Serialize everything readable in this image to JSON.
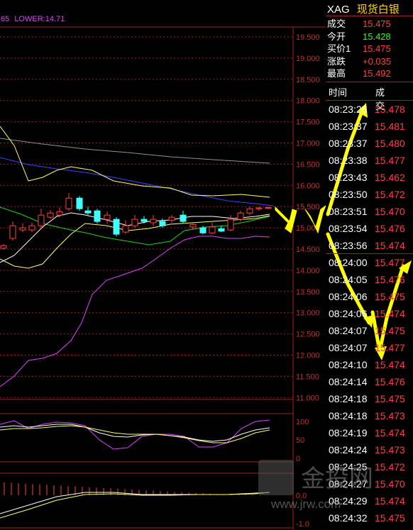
{
  "header": {
    "code": "XAG",
    "name": "现货白银"
  },
  "legend": {
    "partial_left": "65",
    "lower": "LOWER:14.71"
  },
  "quote": [
    {
      "label": "成交",
      "value": "15.475",
      "color": "#ff4040"
    },
    {
      "label": "今开",
      "value": "15.428",
      "color": "#20ff20"
    },
    {
      "label": "买价1",
      "value": "15.475",
      "color": "#ff4040"
    },
    {
      "label": "涨跌",
      "value": "+0.035",
      "color": "#ff4040"
    },
    {
      "label": "最高",
      "value": "15.492",
      "color": "#ff4040"
    }
  ],
  "ticks_header": {
    "time": "时间",
    "price": "成交"
  },
  "ticks": [
    {
      "time": "08:23:26",
      "price": "15.478"
    },
    {
      "time": "08:23:37",
      "price": "15.481"
    },
    {
      "time": "08:23:37",
      "price": "15.480"
    },
    {
      "time": "08:23:38",
      "price": "15.477"
    },
    {
      "time": "08:23:43",
      "price": "15.462"
    },
    {
      "time": "08:23:50",
      "price": "15.472"
    },
    {
      "time": "08:23:51",
      "price": "15.470"
    },
    {
      "time": "08:23:54",
      "price": "15.476"
    },
    {
      "time": "08:23:56",
      "price": "15.474"
    },
    {
      "time": "08:24:00",
      "price": "15.477"
    },
    {
      "time": "08:24:05",
      "price": "15.476"
    },
    {
      "time": "08:24:06",
      "price": "15.475"
    },
    {
      "time": "08:24:06",
      "price": "15.474"
    },
    {
      "time": "08:24:07",
      "price": "15.475"
    },
    {
      "time": "08:24:07",
      "price": "15.477"
    },
    {
      "time": "08:24:10",
      "price": "15.474"
    },
    {
      "time": "08:24:14",
      "price": "15.476"
    },
    {
      "time": "08:24:18",
      "price": "15.475"
    },
    {
      "time": "08:24:18",
      "price": "15.473"
    },
    {
      "time": "08:24:19",
      "price": "15.474"
    },
    {
      "time": "08:24:24",
      "price": "15.473"
    },
    {
      "time": "08:24:25",
      "price": "15.472"
    },
    {
      "time": "08:24:27",
      "price": "15.470"
    },
    {
      "time": "08:24:29",
      "price": "15.474"
    },
    {
      "time": "08:24:32",
      "price": "15.475"
    }
  ],
  "main_axis": [
    "19.500",
    "19.000",
    "18.500",
    "18.000",
    "17.500",
    "17.000",
    "16.500",
    "16.000",
    "15.500",
    "15.000",
    "14.500",
    "14.000",
    "13.500",
    "13.000",
    "12.500",
    "12.000",
    "11.500",
    "11.000"
  ],
  "osc_axis": [
    "100",
    "50",
    "0"
  ],
  "macd_axis": [
    "0.0",
    "-1.0"
  ],
  "watermark": {
    "brand": "金投网",
    "url": "www.jrw.com"
  },
  "colors": {
    "up": "#ff4040",
    "down": "#40ffff",
    "grid": "#a02020",
    "ma_white": "#ffffff",
    "ma_yellow": "#ffff60",
    "ma_green": "#20d020",
    "ma_blue": "#4040ff",
    "ma_gray": "#909090",
    "boll": "#e040ff",
    "arrow": "#ffff00"
  }
}
